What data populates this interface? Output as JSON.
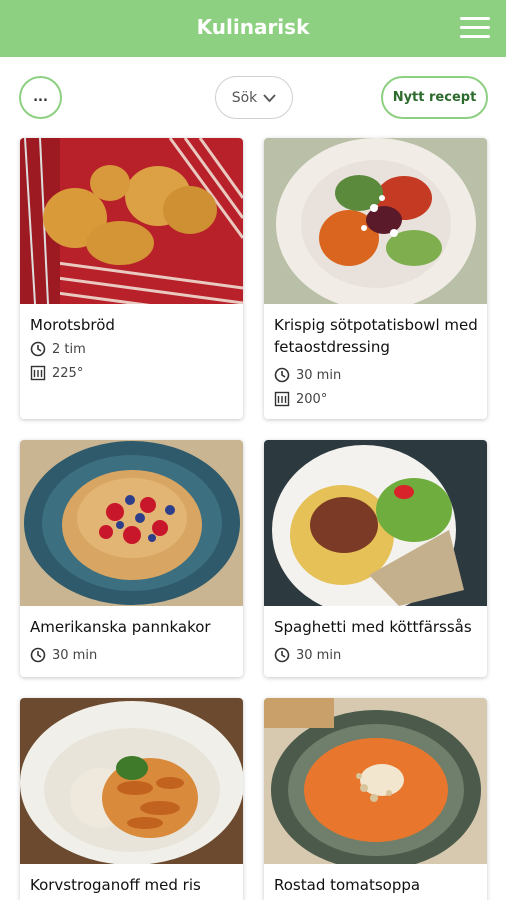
{
  "app": {
    "title": "Kulinarisk"
  },
  "toolbar": {
    "more_label": "...",
    "search_label": "Sök",
    "new_recipe_label": "Nytt recept"
  },
  "recipes": [
    {
      "name": "Morotsbröd",
      "time": "2 tim",
      "oven": "225°"
    },
    {
      "name": "Krispig sötpotatisbowl med fetaostdressing",
      "time": "30 min",
      "oven": "200°"
    },
    {
      "name": "Amerikanska pannkakor",
      "time": "30 min"
    },
    {
      "name": "Spaghetti med köttfärssås",
      "time": "30 min"
    },
    {
      "name": "Korvstroganoff med ris"
    },
    {
      "name": "Rostad tomatsoppa"
    }
  ],
  "colors": {
    "accent": "#8ed081",
    "accent_text": "#2d6b2d"
  }
}
